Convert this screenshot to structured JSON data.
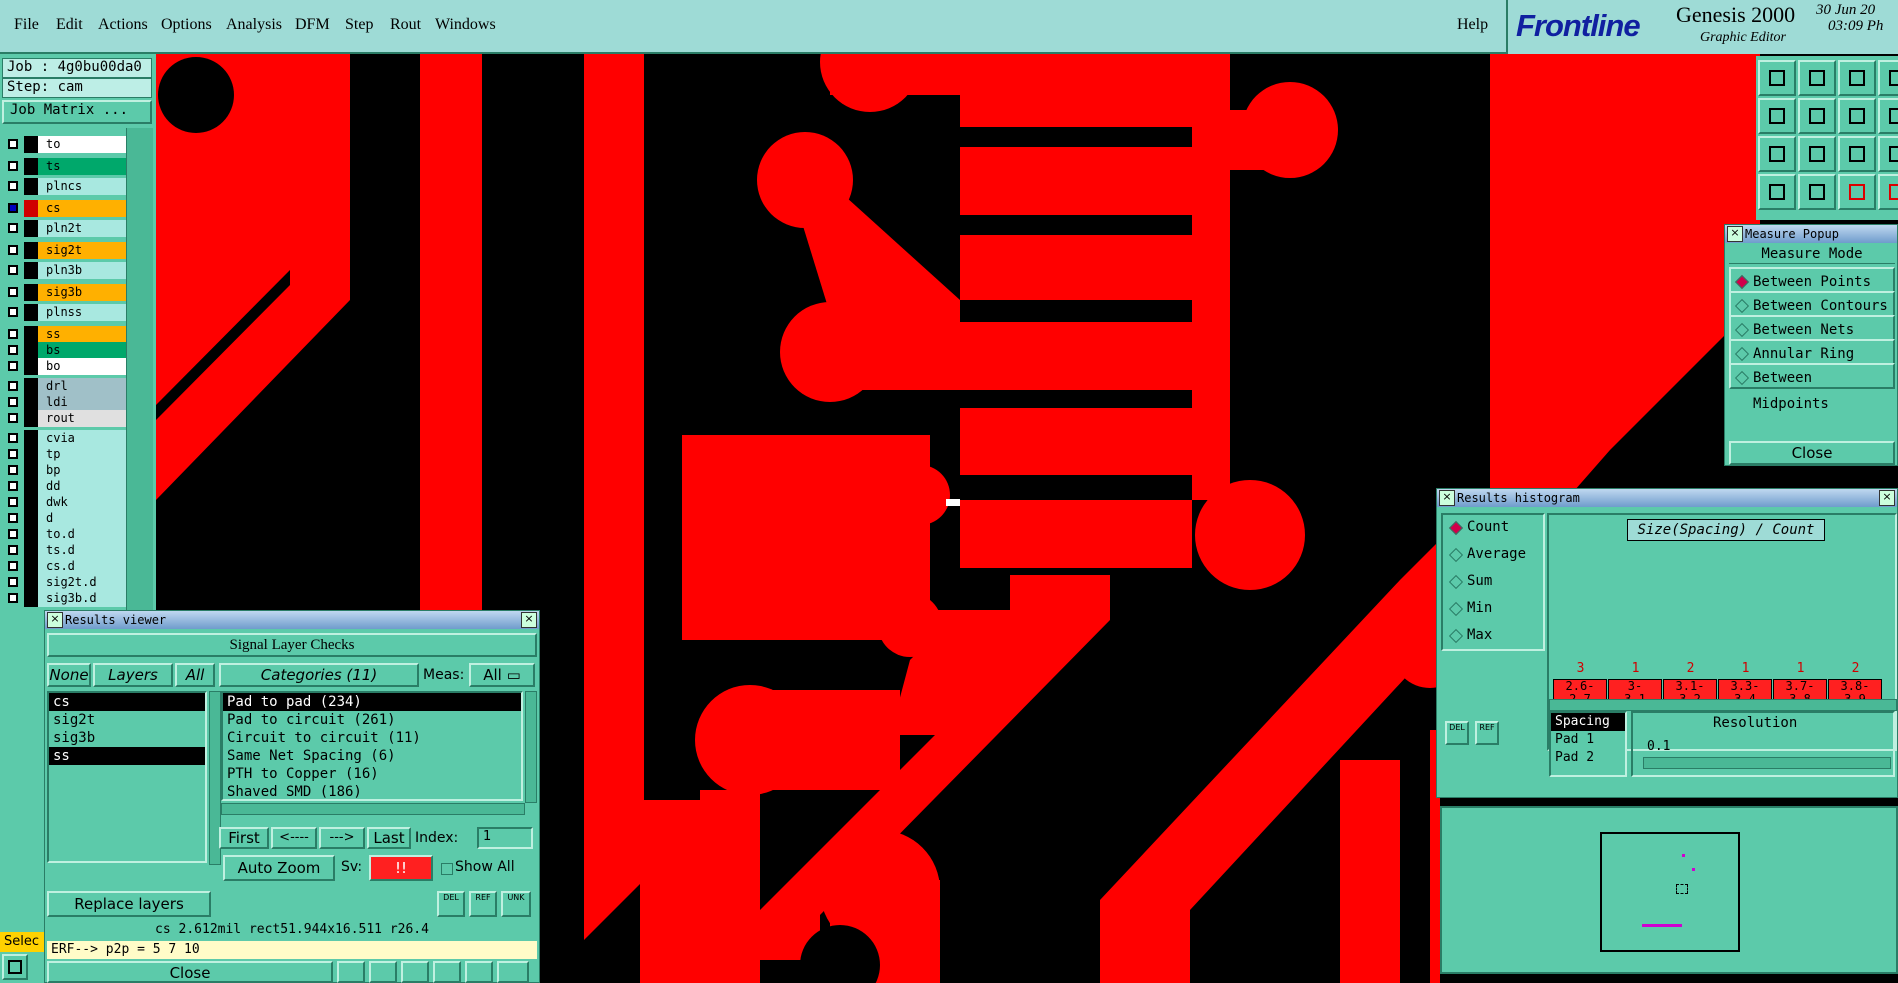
{
  "menu": [
    "File",
    "Edit",
    "Actions",
    "Options",
    "Analysis",
    "DFM",
    "Step",
    "Rout",
    "Windows"
  ],
  "help": "Help",
  "brand": {
    "logo": "Frontline",
    "product": "Genesis 2000",
    "subtitle": "Graphic Editor",
    "date": "30 Jun 20",
    "time": "03:09 Ph"
  },
  "job": {
    "name": "Job : 4g0bu00da0",
    "step": "Step: cam",
    "matrix_btn": "Job Matrix ..."
  },
  "layers": [
    {
      "name": "to",
      "color": "#ffffff"
    },
    {
      "name": "ts",
      "color": "#00a86b"
    },
    {
      "name": "plncs",
      "color": "#a8e8e0"
    },
    {
      "name": "cs",
      "color": "#ffb000"
    },
    {
      "name": "pln2t",
      "color": "#a8e8e0"
    },
    {
      "name": "sig2t",
      "color": "#ffb000"
    },
    {
      "name": "pln3b",
      "color": "#a8e8e0"
    },
    {
      "name": "sig3b",
      "color": "#ffb000"
    },
    {
      "name": "plnss",
      "color": "#a8e8e0"
    },
    {
      "name": "ss",
      "color": "#ffb000"
    },
    {
      "name": "bs",
      "color": "#00a86b"
    },
    {
      "name": "bo",
      "color": "#ffffff"
    },
    {
      "name": "drl",
      "color": "#a0c0c8"
    },
    {
      "name": "ldi",
      "color": "#a0c0c8"
    },
    {
      "name": "rout",
      "color": "#e0e0e0"
    },
    {
      "name": "cvia",
      "color": "#a8e8e0"
    },
    {
      "name": "tp",
      "color": "#a8e8e0"
    },
    {
      "name": "bp",
      "color": "#a8e8e0"
    },
    {
      "name": "dd",
      "color": "#a8e8e0"
    },
    {
      "name": "dwk",
      "color": "#a8e8e0"
    },
    {
      "name": "d",
      "color": "#a8e8e0"
    },
    {
      "name": "to.d",
      "color": "#a8e8e0"
    },
    {
      "name": "ts.d",
      "color": "#a8e8e0"
    },
    {
      "name": "cs.d",
      "color": "#a8e8e0"
    },
    {
      "name": "sig2t.d",
      "color": "#a8e8e0"
    },
    {
      "name": "sig3b.d",
      "color": "#a8e8e0"
    }
  ],
  "select_label": "Selec",
  "results_viewer": {
    "title": "Results viewer",
    "header": "Signal Layer Checks",
    "none": "None",
    "layers": "Layers",
    "all": "All",
    "categories": "Categories (11)",
    "meas_label": "Meas:",
    "meas_value": "All",
    "layer_list": [
      {
        "t": "cs",
        "sel": true
      },
      {
        "t": "sig2t",
        "sel": false
      },
      {
        "t": "sig3b",
        "sel": false
      },
      {
        "t": "ss",
        "sel": true
      }
    ],
    "cat_list": [
      {
        "t": "Pad to pad (234)",
        "sel": true
      },
      {
        "t": "Pad to circuit (261)",
        "sel": false
      },
      {
        "t": "Circuit to circuit (11)",
        "sel": false
      },
      {
        "t": "Same Net Spacing (6)",
        "sel": false
      },
      {
        "t": "PTH to Copper (16)",
        "sel": false
      },
      {
        "t": "Shaved SMD (186)",
        "sel": false
      }
    ],
    "first": "First",
    "prev": "<----",
    "next": "--->",
    "last": "Last",
    "index_label": "Index:",
    "index_value": "1",
    "autozoom": "Auto Zoom",
    "sv_label": "Sv:",
    "sv_value": "!!",
    "show_all": "Show All",
    "replace": "Replace layers",
    "del": "DEL",
    "ref": "REF",
    "unk": "UNK",
    "info": "cs 2.612mil  rect51.944x16.511  r26.4",
    "erf": "ERF--> p2p = 5 7 10",
    "close": "Close"
  },
  "measure": {
    "title": "Measure Popup",
    "mode": "Measure Mode",
    "options": [
      {
        "t": "Between Points",
        "on": true
      },
      {
        "t": "Between Contours",
        "on": false
      },
      {
        "t": "Between Nets",
        "on": false
      },
      {
        "t": "Annular Ring",
        "on": false
      },
      {
        "t": "Between Midpoints",
        "on": false
      }
    ],
    "close": "Close"
  },
  "histogram": {
    "title": "Results histogram",
    "options": [
      {
        "t": "Count",
        "on": true
      },
      {
        "t": "Average",
        "on": false
      },
      {
        "t": "Sum",
        "on": false
      },
      {
        "t": "Min",
        "on": false
      },
      {
        "t": "Max",
        "on": false
      }
    ],
    "chart_title": "Size(Spacing) / Count",
    "bins": [
      {
        "c": "3",
        "r1": "2.6-",
        "r2": "2.7"
      },
      {
        "c": "1",
        "r1": "3-",
        "r2": "3.1"
      },
      {
        "c": "2",
        "r1": "3.1-",
        "r2": "3.2"
      },
      {
        "c": "1",
        "r1": "3.3-",
        "r2": "3.4"
      },
      {
        "c": "1",
        "r1": "3.7-",
        "r2": "3.8"
      },
      {
        "c": "2",
        "r1": "3.8-",
        "r2": "3.9"
      }
    ],
    "spacing_list": [
      "Spacing",
      "Pad 1",
      "Pad 2"
    ],
    "resolution_label": "Resolution",
    "resolution_value": "0.1",
    "del": "DEL",
    "ref": "REF"
  },
  "colors": {
    "copper": "#ff0000",
    "panel": "#5ccaaa",
    "menubar": "#9edbd6",
    "background": "#000000"
  }
}
